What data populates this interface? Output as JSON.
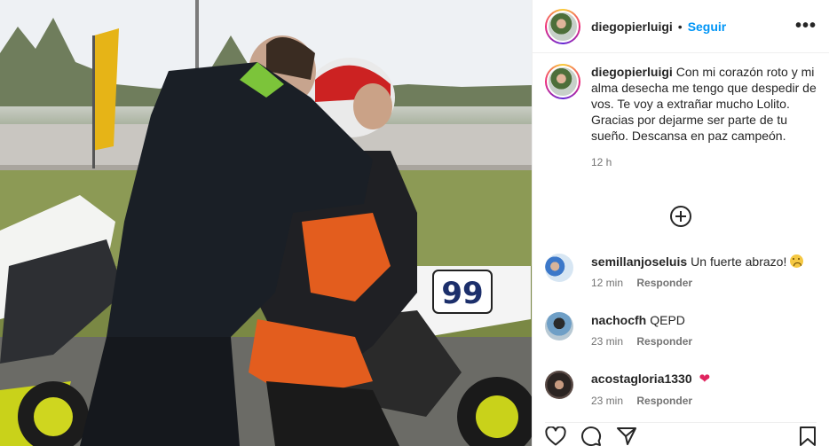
{
  "post": {
    "username": "diegopierluigi",
    "separator": "•",
    "follow_label": "Seguir",
    "more_label": "•••",
    "caption_text": "Con mi corazón roto y mi alma desecha me tengo que despedir de vos. Te voy a extrañar mucho Lolito. Gracias por dejarme ser parte de tu sueño. Descansa en paz campeón.",
    "caption_time": "12 h",
    "photo_bike_number": "99"
  },
  "comments": [
    {
      "username": "semillanjoseluis",
      "text": "Un fuerte abrazo!",
      "emoji": "sad-face-emoji",
      "time": "12 min",
      "reply_label": "Responder"
    },
    {
      "username": "nachocfh",
      "text": "QEPD",
      "time": "23 min",
      "reply_label": "Responder"
    },
    {
      "username": "acostagloria1330",
      "text": "",
      "emoji": "red-heart-emoji",
      "emoji_char": "❤",
      "time": "23 min",
      "reply_label": "Responder"
    }
  ],
  "actions": {
    "like_icon": "heart-icon",
    "comment_icon": "comment-icon",
    "share_icon": "share-icon",
    "save_icon": "bookmark-icon"
  },
  "colors": {
    "accent": "#0095f6",
    "text": "#262626",
    "muted": "#737373",
    "heart": "#e0245e"
  }
}
